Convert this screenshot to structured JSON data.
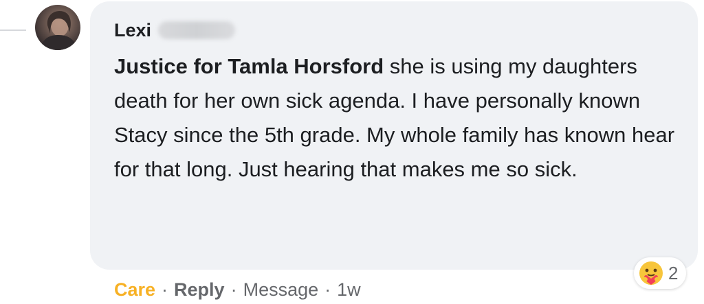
{
  "comment": {
    "author": "Lexi",
    "mention": "Justice for Tamla Horsford",
    "body": " she is using my daughters death for her own sick agenda. I have personally known Stacy since the 5th grade. My whole family has known hear for that long. Just hearing that makes me so sick."
  },
  "reactions": {
    "icon": "care-emoji-icon",
    "count": "2"
  },
  "actions": {
    "care_label": "Care",
    "separator": "·",
    "reply_label": "Reply",
    "message_label": "Message",
    "timestamp": "1w"
  },
  "colors": {
    "bubble": "#f0f2f5",
    "text": "#1c1e21",
    "muted": "#65676b",
    "care": "#f7b125"
  }
}
